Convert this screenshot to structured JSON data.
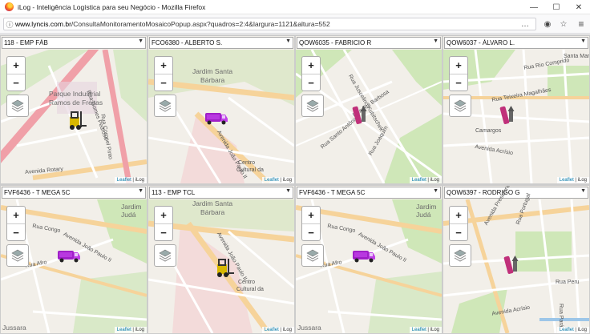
{
  "window": {
    "title": "iLog - Inteligência Logística para seu Negócio - Mozilla Firefox",
    "minimize": "—",
    "maximize": "☐",
    "close": "✕"
  },
  "urlbar": {
    "host": "www.lyncis.com.br",
    "path": "/ConsultaMonitoramentoMosaicoPopup.aspx?quadros=2:4&largura=1121&altura=552",
    "info_icon": "ⓘ",
    "more_icon": "…",
    "pocket_icon": "◉",
    "star_icon": "☆",
    "menu_icon": "≡"
  },
  "map_controls": {
    "zoom_in": "+",
    "zoom_out": "−",
    "attribution_leaflet": "Leaflet",
    "attribution_sep": " | ",
    "attribution_ilog": "iLog"
  },
  "panels": [
    {
      "vehicle": "118 - EMP FÁB",
      "labels": [
        "Parque Industrial",
        "Ramos de Freitas",
        "Avenida Rotary",
        "Rua Coronel Pinto",
        "Rua Gomes Pedrosa"
      ],
      "icon": "forklift-icon"
    },
    {
      "vehicle": "FCO6380 - ALBERTO S.",
      "labels": [
        "Jardim Santa",
        "Bárbara",
        "Avenida João Paulo II",
        "Centro",
        "Cultural da"
      ],
      "icon": "van-icon"
    },
    {
      "vehicle": "QOW6035 - FABRICIO R",
      "labels": [
        "Rua Juscelino Kubitschek",
        "Rua Rui Barbosa",
        "Rua Santo Antônio",
        "Rua Joaquim"
      ],
      "icon": "truck-icon"
    },
    {
      "vehicle": "QOW6037 - ÁLVARO L.",
      "labels": [
        "Santa Maria",
        "Rua Rio Comprido",
        "Camargos",
        "Avenida Acrísio",
        "Rua Teixeira Magalhães"
      ],
      "icon": "truck-icon"
    },
    {
      "vehicle": "FVF6436 - T MEGA 5C",
      "labels": [
        "Rua Congo",
        "Avenida João Paulo II",
        "Rua Afro",
        "Jardim",
        "Judá",
        "Jussara"
      ],
      "icon": "van-icon"
    },
    {
      "vehicle": "113 - EMP TCL",
      "labels": [
        "Jardim Santa",
        "Bárbara",
        "Avenida João Paulo II",
        "Centro",
        "Cultural da"
      ],
      "icon": "forklift-icon"
    },
    {
      "vehicle": "FVF6436 - T MEGA 5C",
      "labels": [
        "Rua Congo",
        "Avenida João Paulo II",
        "Rua Afro",
        "Jardim",
        "Judá",
        "Jussara"
      ],
      "icon": "van-icon"
    },
    {
      "vehicle": "QOW6397 - RODRIGO G",
      "labels": [
        "Avenida Presidente Vargas",
        "Rua Peru",
        "Avenida Acrísio",
        "Rua Portugal",
        "Rua Pará"
      ],
      "icon": "truck-icon"
    }
  ]
}
